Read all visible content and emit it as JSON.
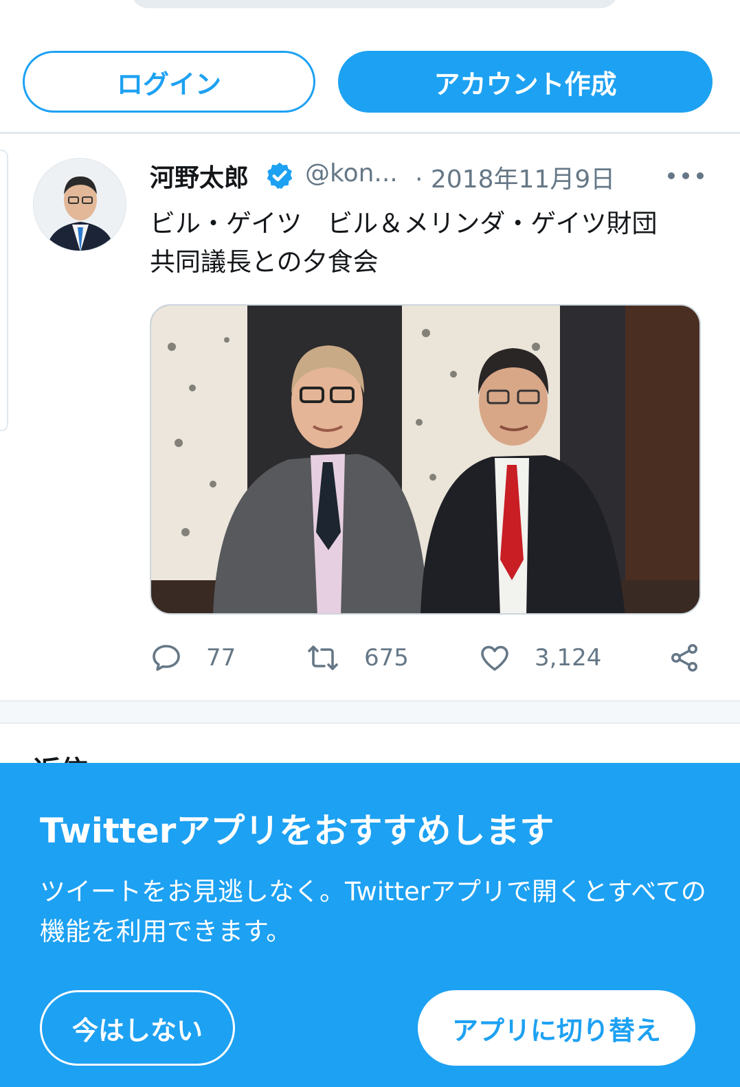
{
  "auth": {
    "login_label": "ログイン",
    "signup_label": "アカウント作成"
  },
  "tweet": {
    "author_name": "河野太郎",
    "verified_icon": "verified-badge-icon",
    "handle": "@kon...",
    "date": "· 2018年11月9日",
    "more_icon": "more-dots-icon",
    "text": "ビル・ゲイツ　ビル＆メリンダ・ゲイツ財団\n共同議長との夕食会",
    "photo_icon": "photo-two-men-portrait",
    "actions": {
      "reply_count": "77",
      "retweet_count": "675",
      "like_count": "3,124"
    }
  },
  "replies": {
    "heading": "返信"
  },
  "app_banner": {
    "title": "Twitterアプリをおすすめします",
    "description": "ツイートをお見逃しなく。Twitterアプリで開くとすべての機能を利用できます。",
    "not_now_label": "今はしない",
    "switch_label": "アプリに切り替え"
  },
  "colors": {
    "brand_blue": "#1da1f2",
    "secondary_text": "#657786",
    "primary_text": "#14171a"
  }
}
